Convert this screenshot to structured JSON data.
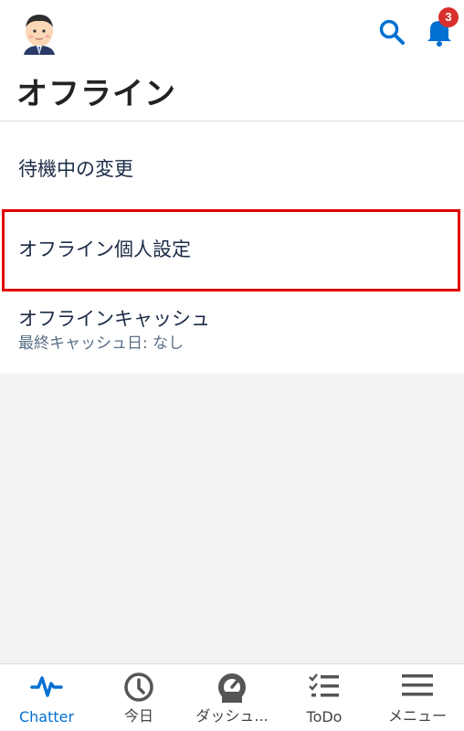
{
  "header": {
    "title": "オフライン",
    "notification_count": "3"
  },
  "list": {
    "items": [
      {
        "label": "待機中の変更"
      },
      {
        "label": "オフライン個人設定"
      },
      {
        "label": "オフラインキャッシュ",
        "sublabel": "最終キャッシュ日: なし"
      }
    ]
  },
  "tabs": [
    {
      "label": "Chatter",
      "icon": "chatter-pulse-icon",
      "active": true
    },
    {
      "label": "今日",
      "icon": "clock-icon"
    },
    {
      "label": "ダッシュ...",
      "icon": "dashboard-gauge-icon"
    },
    {
      "label": "ToDo",
      "icon": "todo-checklist-icon"
    },
    {
      "label": "メニュー",
      "icon": "menu-hamburger-icon"
    }
  ],
  "colors": {
    "accent": "#0070d2",
    "badge": "#d9302c",
    "highlight": "#e00000"
  }
}
